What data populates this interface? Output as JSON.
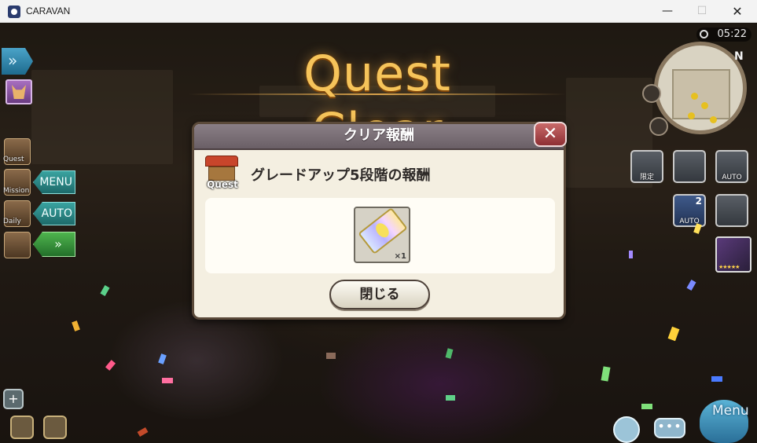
{
  "window": {
    "title": "CARAVAN",
    "minimize_glyph": "—",
    "maximize_glyph": "☐",
    "close_glyph": "✕"
  },
  "hud": {
    "clock": "05:22",
    "compass_label": "N",
    "left_menu": [
      {
        "label": "Quest",
        "icon": "quest-icon"
      },
      {
        "label": "Mission",
        "icon": "mission-icon"
      },
      {
        "label": "Daily",
        "icon": "daily-icon"
      }
    ],
    "menu_tab": "MENU",
    "auto_tab": "AUTO",
    "right_buttons": [
      {
        "label": "限定",
        "icon": "limited-hat-icon"
      },
      {
        "label": "",
        "icon": "camera-icon"
      },
      {
        "label": "AUTO",
        "icon": "auto-target-icon"
      },
      {
        "label": "AUTO",
        "badge": "2",
        "icon": "auto-sword-icon"
      },
      {
        "label": "",
        "icon": "party-icon"
      }
    ],
    "bottom_right_menu": "Menu"
  },
  "banner": {
    "text": "Quest Clear"
  },
  "dialog": {
    "title": "クリア報酬",
    "quest_icon_label": "Quest",
    "subtitle": "グレードアップ5段階の報酬",
    "reward": {
      "icon": "ticket-icon",
      "quantity": "×1"
    },
    "close_button": "閉じる",
    "x_button": "✕"
  },
  "colors": {
    "banner_gold": "#f6c45a",
    "dialog_header": "#7a6f76",
    "dialog_body": "#f4efe1",
    "close_red": "#b04a4e",
    "tab_teal": "#2b8a87"
  }
}
